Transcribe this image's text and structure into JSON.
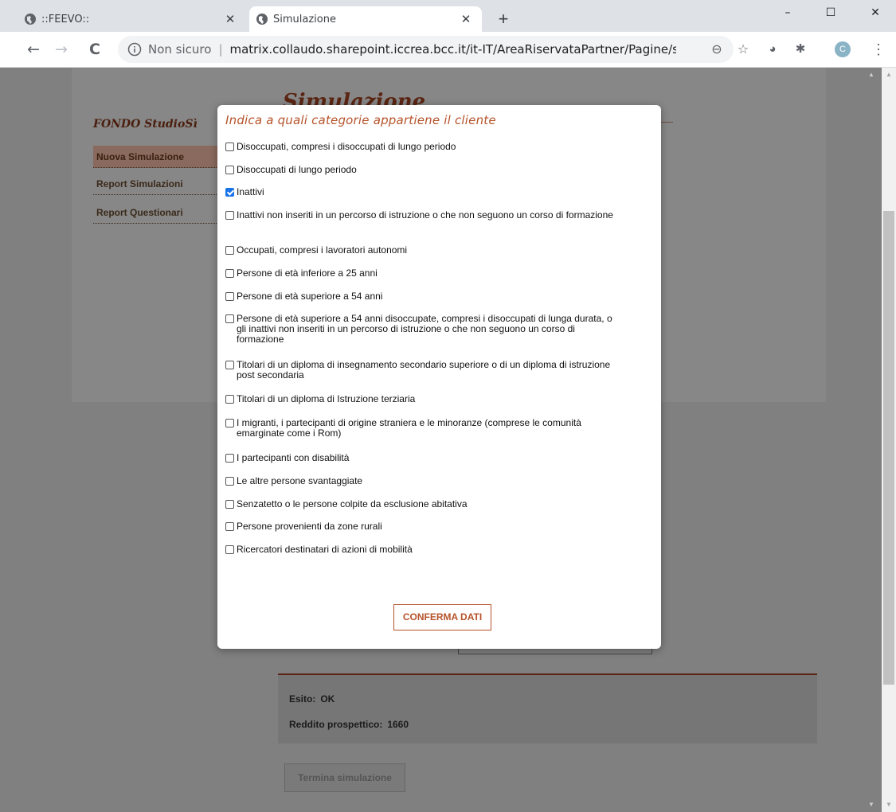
{
  "browser": {
    "tabs": [
      {
        "title": "::FEEVO::",
        "active": false
      },
      {
        "title": "Simulazione",
        "active": true
      }
    ],
    "new_tab": "+",
    "window_controls": {
      "minimize": "–",
      "maximize": "☐",
      "close": "✕"
    },
    "nav": {
      "back": "←",
      "forward": "→",
      "reload": "C"
    },
    "address": {
      "security_label": "Non sicuro",
      "separator": "|",
      "url": "matrix.collaudo.sharepoint.iccrea.bcc.it/it-IT/AreaRiservataPartner/Pagine/st..."
    },
    "profile_initial": "C",
    "menu": "⋮"
  },
  "page": {
    "title": "Simulazione",
    "brand": "FONDO StudioSì",
    "sidebar": [
      {
        "label": "Nuova Simulazione",
        "active": true
      },
      {
        "label": "Report Simulazioni",
        "active": false
      },
      {
        "label": "Report Questionari",
        "active": false
      }
    ],
    "result": {
      "esito_label": "Esito:",
      "esito_value": "OK",
      "reddito_label": "Reddito prospettico:",
      "reddito_value": "1660"
    },
    "end_button": "Termina simulazione"
  },
  "modal": {
    "title": "Indica a quali categorie appartiene il cliente",
    "options": [
      {
        "label": "Disoccupati, compresi i disoccupati di lungo periodo",
        "checked": false
      },
      {
        "label": "Disoccupati di lungo periodo",
        "checked": false
      },
      {
        "label": "Inattivi",
        "checked": true
      },
      {
        "label": "Inattivi non inseriti in un percorso di istruzione o che non seguono un corso di formazione",
        "checked": false
      },
      {
        "label": "Occupati, compresi i lavoratori autonomi",
        "checked": false
      },
      {
        "label": "Persone di età inferiore a 25 anni",
        "checked": false
      },
      {
        "label": "Persone di età superiore a 54 anni",
        "checked": false
      },
      {
        "label": "Persone di età superiore a 54 anni disoccupate, compresi i disoccupati di lunga durata, o gli inattivi non inseriti in un percorso di istruzione o che non seguono un corso di formazione",
        "checked": false
      },
      {
        "label": "Titolari di un diploma di insegnamento secondario superiore o di un diploma di istruzione post secondaria",
        "checked": false
      },
      {
        "label": "Titolari di un diploma di Istruzione terziaria",
        "checked": false
      },
      {
        "label": "I migranti, i partecipanti di origine straniera e le minoranze (comprese le comunità emarginate come i Rom)",
        "checked": false
      },
      {
        "label": "I partecipanti con disabilità",
        "checked": false
      },
      {
        "label": "Le altre persone svantaggiate",
        "checked": false
      },
      {
        "label": "Senzatetto o le persone colpite da esclusione abitativa",
        "checked": false
      },
      {
        "label": "Persone provenienti da zone rurali",
        "checked": false
      },
      {
        "label": "Ricercatori destinatari di azioni di mobilità",
        "checked": false
      }
    ],
    "confirm_label": "CONFERMA DATI"
  },
  "colors": {
    "accent": "#b5532a",
    "checkbox_checked": "#1a73e8",
    "overlay": "#808080"
  }
}
